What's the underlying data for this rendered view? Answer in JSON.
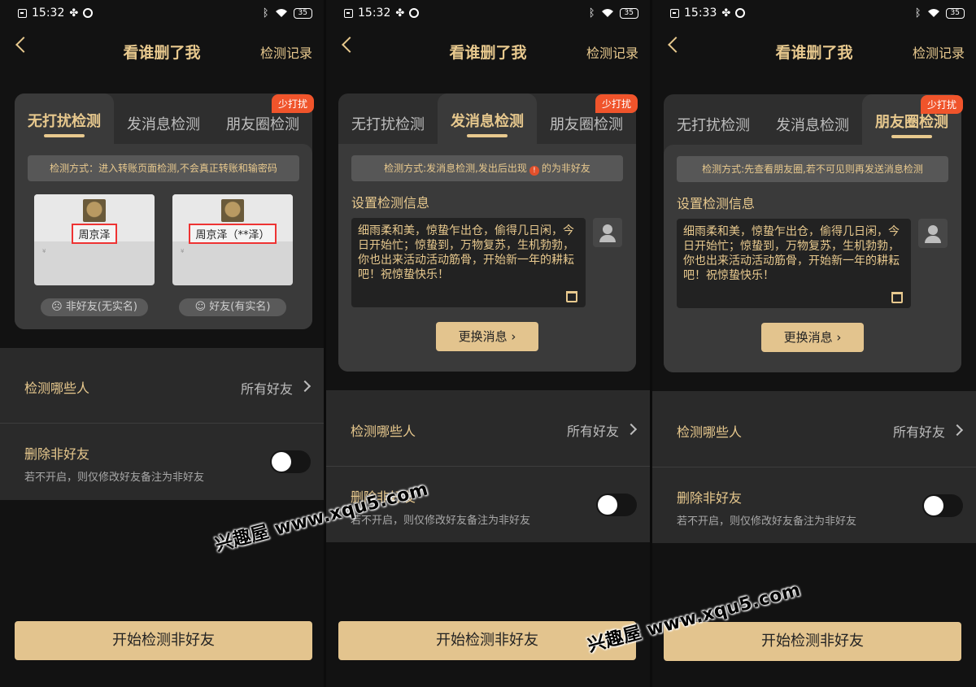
{
  "status_times": [
    "15:32",
    "15:32",
    "15:33"
  ],
  "battery": "35",
  "header": {
    "title": "看谁删了我",
    "record": "检测记录"
  },
  "tabs": [
    "无打扰检测",
    "发消息检测",
    "朋友圈检测"
  ],
  "badge": "少打扰",
  "screen1": {
    "method": "检测方式：进入转账页面检测,不会真正转账和输密码",
    "samples": [
      {
        "name": "周京泽",
        "pill": "非好友(无实名)"
      },
      {
        "name": "周京泽（**泽）",
        "pill": "好友(有实名)"
      }
    ]
  },
  "screen2": {
    "method_a": "检测方式:发消息检测,发出后出现",
    "method_b": "的为非好友"
  },
  "screen3": {
    "method": "检测方式:先查看朋友圈,若不可见则再发送消息检测"
  },
  "set_info_label": "设置检测信息",
  "message": "细雨柔和美，惊蛰乍出仓，偷得几日闲，今日开始忙；惊蛰到，万物复苏，生机勃勃，你也出来活动活动筋骨，开始新一年的耕耘吧！祝惊蛰快乐！",
  "change_btn": "更换消息",
  "detect_who": "检测哪些人",
  "all_friends": "所有好友",
  "delete_non": "删除非好友",
  "delete_sub": "若不开启，则仅修改好友备注为非好友",
  "start_btn": "开始检测非好友",
  "watermark": "兴趣屋 www.xqu5.com"
}
